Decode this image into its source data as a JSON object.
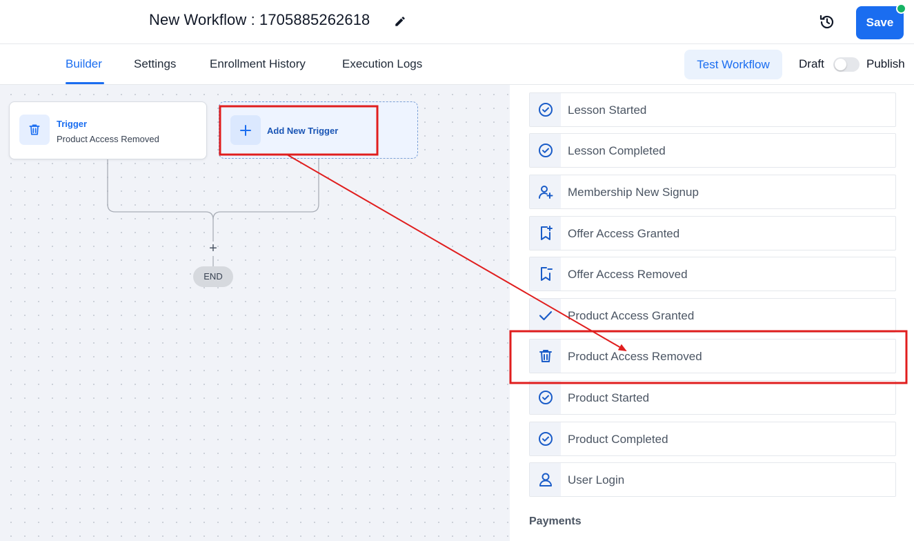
{
  "header": {
    "title": "New Workflow : 1705885262618",
    "save_label": "Save"
  },
  "tabs": [
    {
      "label": "Builder",
      "active": true
    },
    {
      "label": "Settings",
      "active": false
    },
    {
      "label": "Enrollment History",
      "active": false
    },
    {
      "label": "Execution Logs",
      "active": false
    }
  ],
  "toolbar": {
    "test_label": "Test Workflow",
    "draft_label": "Draft",
    "publish_label": "Publish",
    "publish_on": false
  },
  "canvas": {
    "trigger_title": "Trigger",
    "trigger_subtitle": "Product Access Removed",
    "add_trigger_label": "Add New Trigger",
    "add_step_symbol": "+",
    "end_label": "END"
  },
  "panel": {
    "items": [
      {
        "label": "Lesson Started",
        "icon": "check-circle-icon"
      },
      {
        "label": "Lesson Completed",
        "icon": "check-circle-icon"
      },
      {
        "label": "Membership New Signup",
        "icon": "user-plus-icon"
      },
      {
        "label": "Offer Access Granted",
        "icon": "bookmark-plus-icon"
      },
      {
        "label": "Offer Access Removed",
        "icon": "bookmark-minus-icon"
      },
      {
        "label": "Product Access Granted",
        "icon": "check-icon"
      },
      {
        "label": "Product Access Removed",
        "icon": "trash-icon"
      },
      {
        "label": "Product Started",
        "icon": "check-circle-icon"
      },
      {
        "label": "Product Completed",
        "icon": "check-circle-icon"
      },
      {
        "label": "User Login",
        "icon": "user-icon"
      }
    ],
    "section_payments": "Payments"
  },
  "colors": {
    "accent": "#1a6df0",
    "annotation": "#e01e1e",
    "status_dot": "#16b364"
  }
}
